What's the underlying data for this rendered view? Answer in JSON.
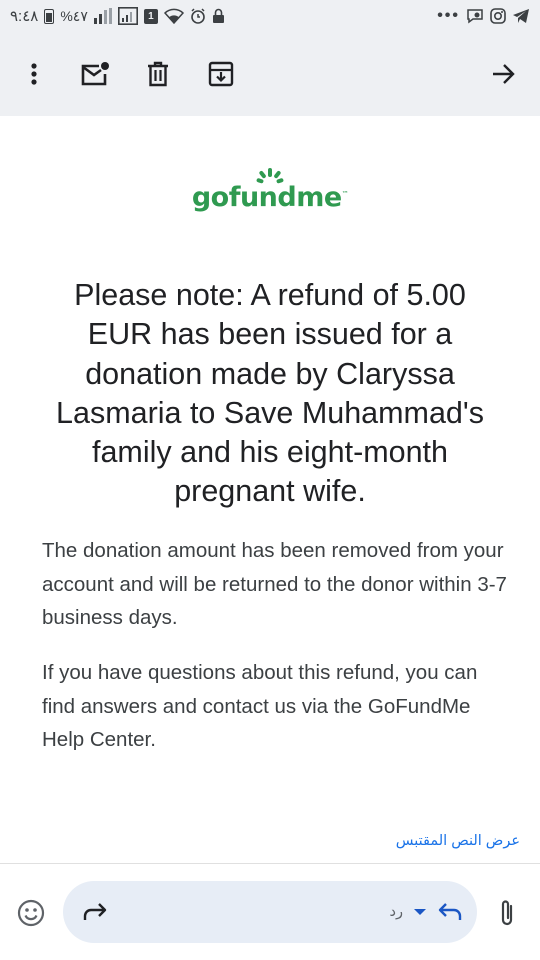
{
  "status_bar": {
    "time": "٩:٤٨",
    "battery": "%٤٧",
    "sim_slot": "1",
    "overflow": "•••"
  },
  "toolbar": {
    "icons": [
      "more-vert-icon",
      "mark-unread-icon",
      "delete-icon",
      "archive-icon",
      "arrow-forward-icon"
    ]
  },
  "email": {
    "logo_text": "gofundme",
    "logo_tm": "™",
    "headline": "Please note: A refund of 5.00 EUR has been issued for a donation made by Claryssa Lasmaria to Save Muhammad's family and his eight-month pregnant wife.",
    "paragraph1": "The donation amount has been removed from your account and will be returned to the donor within 3-7 business days.",
    "paragraph2": "If you have questions about this refund, you can find answers and contact us via the GoFundMe Help Center.",
    "show_quoted": "عرض النص المقتبس"
  },
  "bottom_bar": {
    "reply_label": "رد",
    "icons": [
      "emoji-icon",
      "forward-icon",
      "dropdown-icon",
      "reply-icon",
      "attachment-icon"
    ]
  },
  "colors": {
    "chrome_bg": "#eef0f3",
    "brand_green": "#2f9a50",
    "link_blue": "#1a73e8",
    "reply_pill": "#e7edf6"
  }
}
